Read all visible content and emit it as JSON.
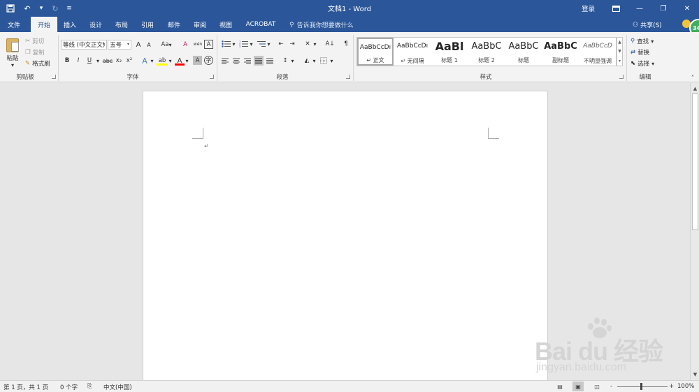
{
  "titlebar": {
    "title": "文档1 - Word",
    "login": "登录",
    "qat": {
      "save_icon": "save-icon",
      "undo_icon": "undo-icon",
      "redo_icon": "redo-icon",
      "customize_icon": "customize-qat-icon"
    }
  },
  "tabs": [
    "文件",
    "开始",
    "插入",
    "设计",
    "布局",
    "引用",
    "邮件",
    "审阅",
    "视图",
    "ACROBAT"
  ],
  "active_tab": "开始",
  "tell_me": "告诉我你想要做什么",
  "share": "共享(S)",
  "avatar_badge": "34",
  "ribbon": {
    "clipboard": {
      "paste": "粘贴",
      "cut": "剪切",
      "copy": "复制",
      "format_painter": "格式刷",
      "label": "剪贴板"
    },
    "font": {
      "font_name": "等线 (中文正文)",
      "font_size": "五号",
      "grow": "A",
      "shrink": "A",
      "case": "Aa",
      "clear_format": "A",
      "phonetic": "wén",
      "border_char": "A",
      "bold": "B",
      "italic": "I",
      "underline": "U",
      "strikethrough": "abc",
      "subscript": "x₂",
      "superscript": "x²",
      "text_effect": "A",
      "highlight": "ab",
      "font_color": "A",
      "shading": "A",
      "enclose": "字",
      "label": "字体"
    },
    "paragraph": {
      "label": "段落",
      "sort": "A↓",
      "show_marks": "¶"
    },
    "styles": {
      "label": "样式",
      "items": [
        {
          "preview": "AaBbCcDı",
          "name": "正文"
        },
        {
          "preview": "AaBbCcDı",
          "name": "无间隔"
        },
        {
          "preview": "AaBl",
          "name": "标题 1"
        },
        {
          "preview": "AaBbC",
          "name": "标题 2"
        },
        {
          "preview": "AaBbC",
          "name": "标题"
        },
        {
          "preview": "AaBbC",
          "name": "副标题"
        },
        {
          "preview": "AaBbCcD",
          "name": "不明显强调"
        }
      ]
    },
    "editing": {
      "find": "查找",
      "replace": "替换",
      "select": "选择",
      "label": "编辑"
    }
  },
  "document": {
    "paragraph_mark": "↵"
  },
  "watermark": {
    "text": "Bai du 经验",
    "url": "jingyan.baidu.com"
  },
  "statusbar": {
    "page": "第 1 页，共 1 页",
    "words": "0 个字",
    "language": "中文(中国)",
    "zoom_minus": "-",
    "zoom_plus": "+",
    "zoom": "100%"
  },
  "colors": {
    "brand": "#2b579a",
    "ribbon_bg": "#f3f3f3",
    "canvas_bg": "#e6e6e6",
    "highlight": "#ffff00",
    "font_color": "#ff0000"
  }
}
